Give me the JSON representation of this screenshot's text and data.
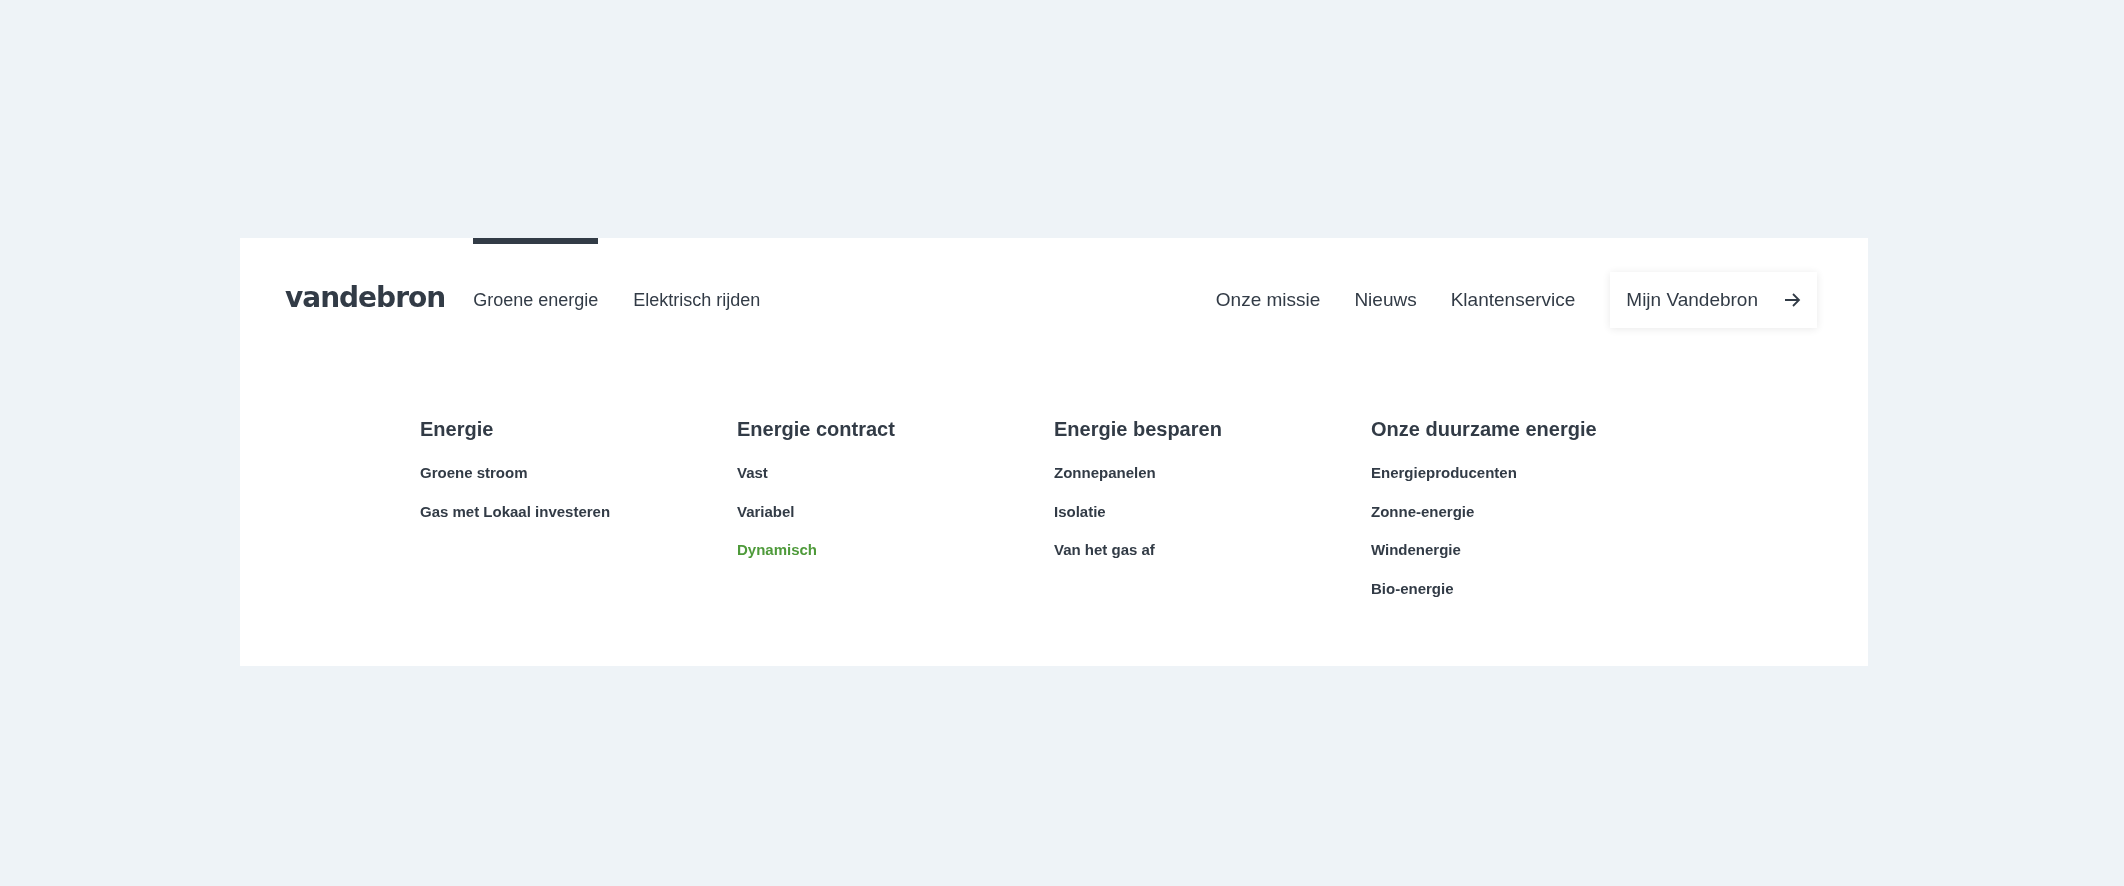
{
  "logo": "vandebron",
  "main_nav": [
    {
      "label": "Groene energie",
      "selected": true
    },
    {
      "label": "Elektrisch rijden",
      "selected": false
    }
  ],
  "secondary_nav": [
    {
      "label": "Onze missie"
    },
    {
      "label": "Nieuws"
    },
    {
      "label": "Klantenservice"
    }
  ],
  "account_button": {
    "label": "Mijn Vandebron"
  },
  "menu_columns": [
    {
      "heading": "Energie",
      "items": [
        {
          "label": "Groene stroom",
          "selected": false
        },
        {
          "label": "Gas met Lokaal investeren",
          "selected": false
        }
      ]
    },
    {
      "heading": "Energie contract",
      "items": [
        {
          "label": "Vast",
          "selected": false
        },
        {
          "label": "Variabel",
          "selected": false
        },
        {
          "label": "Dynamisch",
          "selected": true
        }
      ]
    },
    {
      "heading": "Energie besparen",
      "items": [
        {
          "label": "Zonnepanelen",
          "selected": false
        },
        {
          "label": "Isolatie",
          "selected": false
        },
        {
          "label": "Van het gas af",
          "selected": false
        }
      ]
    },
    {
      "heading": "Onze duurzame energie",
      "items": [
        {
          "label": "Energieproducenten",
          "selected": false
        },
        {
          "label": "Zonne-energie",
          "selected": false
        },
        {
          "label": "Windenergie",
          "selected": false
        },
        {
          "label": "Bio-energie",
          "selected": false
        }
      ]
    }
  ]
}
